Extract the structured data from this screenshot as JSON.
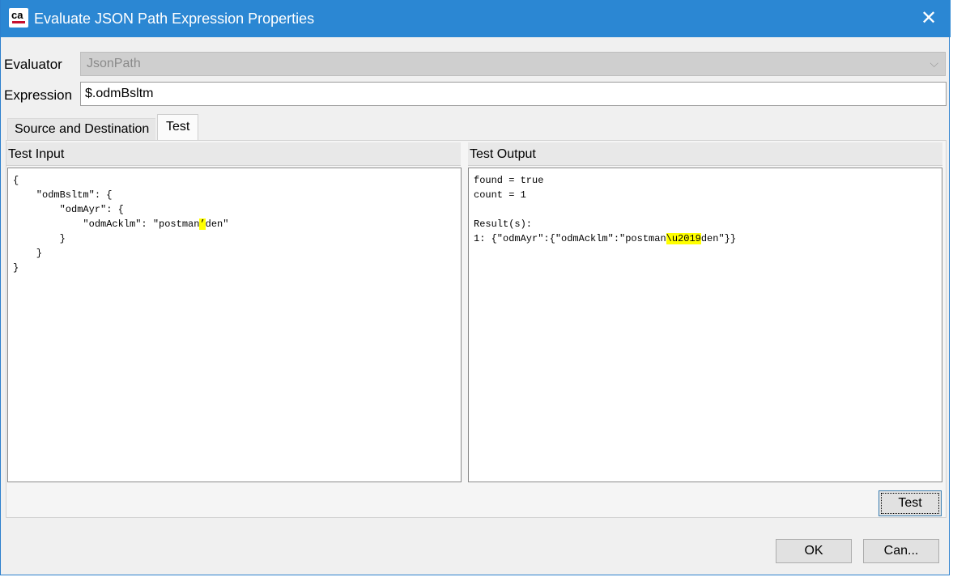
{
  "window": {
    "title": "Evaluate JSON Path Expression Properties",
    "close_glyph": "✕"
  },
  "form": {
    "evaluator_label": "Evaluator",
    "evaluator_value": "JsonPath",
    "expression_label": "Expression",
    "expression_value": "$.odmBsltm"
  },
  "tabs": [
    {
      "label": "Source and Destination",
      "selected": false
    },
    {
      "label": "Test",
      "selected": true
    }
  ],
  "test_input": {
    "header": "Test Input",
    "lines": [
      "{",
      "    \"odmBsltm\": {",
      "        \"odmAyr\": {",
      "            \"odmAcklm\": \"postman",
      "’",
      "den\"",
      "        }",
      "    }",
      "}"
    ]
  },
  "test_output": {
    "header": "Test Output",
    "lines": [
      "found = true",
      "count = 1",
      "",
      "Result(s):",
      "1: {\"odmAyr\":{\"odmAcklm\":\"postman",
      "\\u2019",
      "den\"}}"
    ]
  },
  "buttons": {
    "test": "Test",
    "ok": "OK",
    "cancel": "Can..."
  },
  "colors": {
    "titlebar": "#2b87d3",
    "highlight": "#ffff00"
  },
  "icons": {
    "app": "ca-logo-icon",
    "combo": "chevron-down-icon",
    "close": "close-icon"
  }
}
